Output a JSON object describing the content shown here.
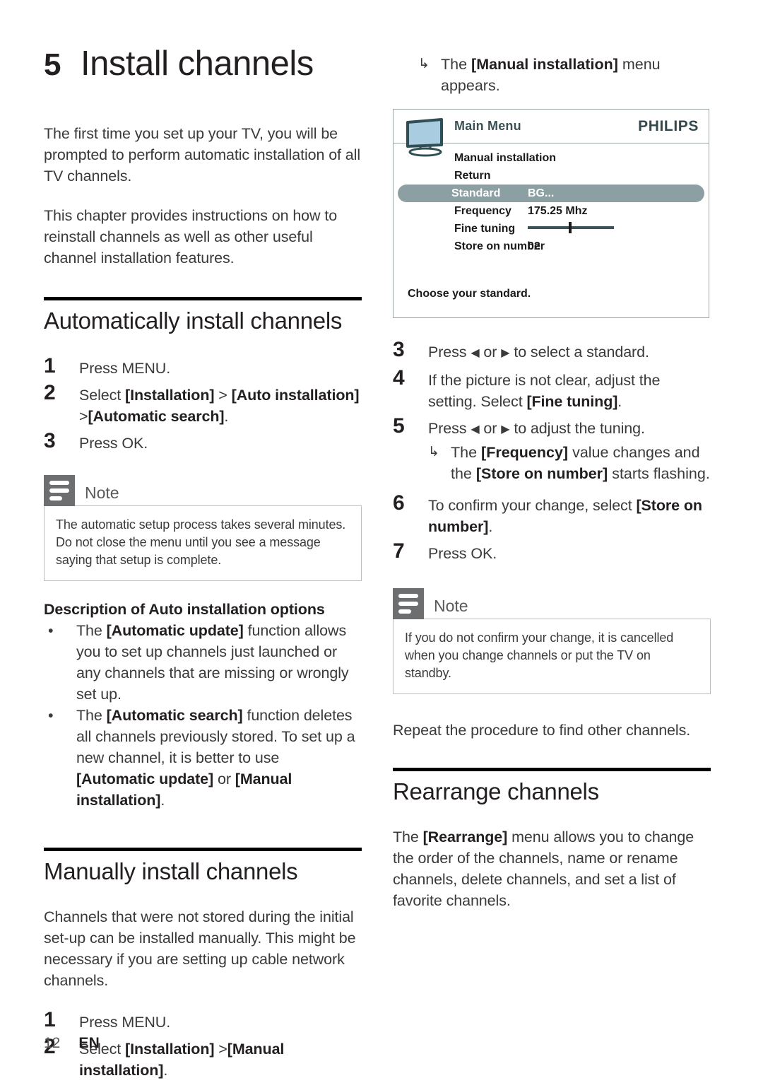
{
  "chapter": {
    "number": "5",
    "title": "Install channels"
  },
  "left": {
    "intro1": "The first time you set up your TV, you will be prompted to perform automatic installation of all TV channels.",
    "intro2": "This chapter provides instructions on how to reinstall channels as well as other useful channel installation features.",
    "auto_section": {
      "heading": "Automatically install channels",
      "steps": [
        {
          "num": "1",
          "text": "Press MENU."
        },
        {
          "num": "2",
          "text_pre": "Select ",
          "bold1": "[Installation]",
          "mid": " > ",
          "bold2": "[Auto installation]",
          "mid2": " >",
          "bold3": "[Automatic search]",
          "text_post": "."
        },
        {
          "num": "3",
          "text": "Press OK."
        }
      ]
    },
    "note": {
      "title": "Note",
      "icon": "note-lines-icon",
      "body": "The automatic setup process takes several minutes. Do not close the menu until you see a message saying that setup is complete."
    },
    "options_heading": "Description of Auto installation options",
    "bullets": [
      {
        "marker": "•",
        "p1": "The ",
        "b1": "[Automatic update]",
        "p2": " function allows you to set up channels just launched or any channels that are missing or wrongly set up."
      },
      {
        "marker": "•",
        "p1": "The ",
        "b1": "[Automatic search]",
        "p2": " function deletes all channels previously stored. To set up a new channel, it is better to use ",
        "b2": "[Automatic update]",
        "p3": " or ",
        "b3": "[Manual installation]",
        "p4": "."
      }
    ],
    "manual_section": {
      "heading": "Manually install channels",
      "intro": "Channels that were not stored during the initial set-up can be installed manually. This might be necessary if you are setting up cable network channels.",
      "steps": [
        {
          "num": "1",
          "text": "Press MENU."
        },
        {
          "num": "2",
          "pre": "Select ",
          "b1": "[Installation]",
          "mid": " >",
          "b2": "[Manual installation]",
          "post": "."
        }
      ]
    }
  },
  "right": {
    "top_arrow": {
      "hook": "↳",
      "pre": "The ",
      "bold": "[Manual installation]",
      "post": " menu appears."
    },
    "osd": {
      "title": "Main Menu",
      "logo": "PHILIPS",
      "tv_icon": "tv-icon",
      "rows": [
        {
          "label": "Manual installation",
          "value": "",
          "selected": false,
          "type": "text"
        },
        {
          "label": "Return",
          "value": "",
          "selected": false,
          "type": "text"
        },
        {
          "label": "Standard",
          "value": "BG...",
          "selected": true,
          "type": "text"
        },
        {
          "label": "Frequency",
          "value": "175.25 Mhz",
          "selected": false,
          "type": "text"
        },
        {
          "label": "Fine tuning",
          "value": "",
          "selected": false,
          "type": "slider"
        },
        {
          "label": "Store on number",
          "value": "02",
          "selected": false,
          "type": "text"
        }
      ],
      "footer": "Choose your standard."
    },
    "steps": [
      {
        "num": "3",
        "pre": "Press ",
        "larr": "◀",
        "mid": " or ",
        "rarr": "▶",
        "post": " to select a standard."
      },
      {
        "num": "4",
        "line1": "If the picture is not clear, adjust the setting.",
        "line2_pre": "Select ",
        "line2_bold": "[Fine tuning]",
        "line2_post": "."
      },
      {
        "num": "5",
        "pre": "Press ",
        "larr": "◀",
        "mid": " or ",
        "rarr": "▶",
        "post": " to adjust the tuning."
      },
      {
        "num": "6",
        "pre": "To confirm your change, select ",
        "bold": "[Store on number]",
        "post": "."
      },
      {
        "num": "7",
        "text": "Press OK."
      }
    ],
    "step5_sub": {
      "hook": "↳",
      "pre": "The ",
      "b1": "[Frequency]",
      "mid": " value changes and the ",
      "b2": "[Store on number]",
      "post": " starts flashing."
    },
    "note": {
      "title": "Note",
      "icon": "note-lines-icon",
      "body": "If you do not confirm your change, it is cancelled when you change channels or put the TV on standby."
    },
    "repeat_text": "Repeat the procedure to find other channels.",
    "rearrange_section": {
      "heading": "Rearrange channels",
      "p_pre": "The ",
      "p_bold": "[Rearrange]",
      "p_post": " menu allows you to change the order of the channels, name or rename channels, delete channels, and set a list of favorite channels."
    }
  },
  "footer": {
    "page": "12",
    "language": "EN"
  },
  "colors": {
    "rule": "#000000",
    "note_icon_bg": "#6d6e70",
    "note_border": "#bcbec0",
    "osd_border": "#9aa7a4",
    "osd_selected": "#8c9fa3",
    "osd_title": "#3c5156",
    "philips_logo": "#33484e",
    "tv_screen": "#aacce0",
    "tv_frame": "#2f4f55"
  }
}
